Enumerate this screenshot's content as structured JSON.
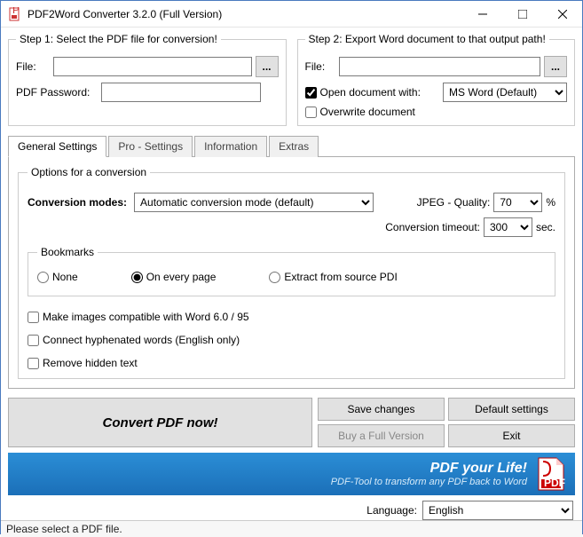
{
  "window": {
    "title": "PDF2Word Converter 3.2.0 (Full Version)"
  },
  "step1": {
    "legend": "Step 1: Select the PDF file for conversion!",
    "file_label": "File:",
    "file_value": "",
    "browse": "...",
    "pwd_label": "PDF Password:",
    "pwd_value": ""
  },
  "step2": {
    "legend": "Step 2: Export Word document to that output path!",
    "file_label": "File:",
    "file_value": "",
    "browse": "...",
    "open_with_label": "Open document with:",
    "open_with_checked": true,
    "open_with_value": "MS Word (Default)",
    "overwrite_label": "Overwrite document",
    "overwrite_checked": false
  },
  "tabs": {
    "general": "General Settings",
    "pro": "Pro - Settings",
    "info": "Information",
    "extras": "Extras"
  },
  "options": {
    "legend": "Options for a conversion",
    "modes_label": "Conversion modes:",
    "modes_value": "Automatic conversion mode (default)",
    "jpeg_label": "JPEG - Quality:",
    "jpeg_value": "70",
    "jpeg_unit": "%",
    "timeout_label": "Conversion timeout:",
    "timeout_value": "300",
    "timeout_unit": "sec."
  },
  "bookmarks": {
    "legend": "Bookmarks",
    "none": "None",
    "every": "On every page",
    "extract": "Extract from source PDI",
    "selected": "every"
  },
  "checks": {
    "images_compat": "Make images compatible with Word 6.0 / 95",
    "images_compat_checked": false,
    "hyphen": "Connect hyphenated words (English only)",
    "hyphen_checked": false,
    "hidden": "Remove hidden text",
    "hidden_checked": false
  },
  "buttons": {
    "convert": "Convert PDF now!",
    "save": "Save changes",
    "defaults": "Default settings",
    "buy": "Buy a Full Version",
    "exit": "Exit"
  },
  "banner": {
    "line1": "PDF your Life!",
    "line2": "PDF-Tool to transform any PDF back to Word"
  },
  "lang": {
    "label": "Language:",
    "value": "English"
  },
  "status": "Please select a PDF file."
}
